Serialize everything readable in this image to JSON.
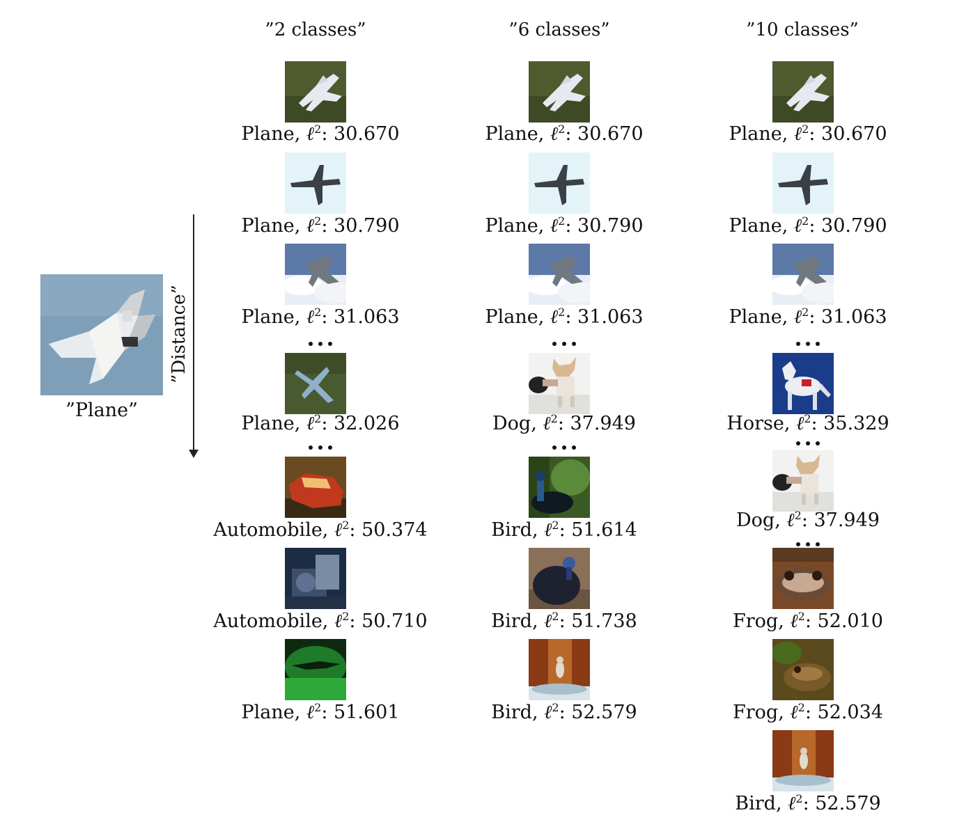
{
  "query": {
    "label": "”Plane”"
  },
  "axis": {
    "label": "”Distance”"
  },
  "columns": [
    {
      "title": "”2 classes”",
      "items": [
        {
          "cls": "Plane",
          "dist": "30.670",
          "img": "plane1"
        },
        {
          "cls": "Plane",
          "dist": "30.790",
          "img": "plane2"
        },
        {
          "cls": "Plane",
          "dist": "31.063",
          "img": "plane3"
        },
        {
          "cls": "Plane",
          "dist": "32.026",
          "img": "plane4"
        },
        {
          "cls": "Automobile",
          "dist": "50.374",
          "img": "car1"
        },
        {
          "cls": "Automobile",
          "dist": "50.710",
          "img": "car2"
        },
        {
          "cls": "Plane",
          "dist": "51.601",
          "img": "greenplane"
        }
      ]
    },
    {
      "title": "”6 classes”",
      "items": [
        {
          "cls": "Plane",
          "dist": "30.670",
          "img": "plane1"
        },
        {
          "cls": "Plane",
          "dist": "30.790",
          "img": "plane2"
        },
        {
          "cls": "Plane",
          "dist": "31.063",
          "img": "plane3"
        },
        {
          "cls": "Dog",
          "dist": "37.949",
          "img": "dog"
        },
        {
          "cls": "Bird",
          "dist": "51.614",
          "img": "bird1"
        },
        {
          "cls": "Bird",
          "dist": "51.738",
          "img": "bird2"
        },
        {
          "cls": "Bird",
          "dist": "52.579",
          "img": "bird3"
        }
      ]
    },
    {
      "title": "”10 classes”",
      "items": [
        {
          "cls": "Plane",
          "dist": "30.670",
          "img": "plane1"
        },
        {
          "cls": "Plane",
          "dist": "30.790",
          "img": "plane2"
        },
        {
          "cls": "Plane",
          "dist": "31.063",
          "img": "plane3"
        },
        {
          "cls": "Horse",
          "dist": "35.329",
          "img": "horse"
        },
        {
          "cls": "Dog",
          "dist": "37.949",
          "img": "dog"
        },
        {
          "cls": "Frog",
          "dist": "52.010",
          "img": "frog1"
        },
        {
          "cls": "Frog",
          "dist": "52.034",
          "img": "frog2"
        },
        {
          "cls": "Bird",
          "dist": "52.579",
          "img": "bird3"
        }
      ]
    }
  ],
  "metric_symbol": "ℓ",
  "metric_power": "2"
}
